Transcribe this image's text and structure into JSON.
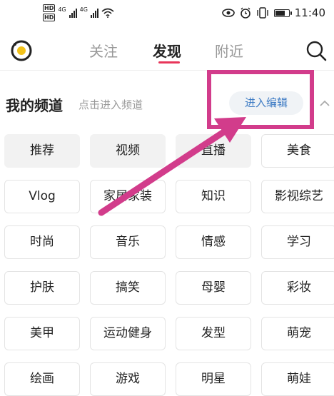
{
  "status_bar": {
    "hd_labels": [
      "HD",
      "HD"
    ],
    "network_labels": [
      "4G",
      "4G"
    ],
    "time": "11:40",
    "icons": [
      "eye-icon",
      "alarm-icon",
      "vibrate-icon",
      "battery-icon"
    ],
    "battery_level": 0.75
  },
  "nav": {
    "tabs": [
      {
        "label": "关注",
        "active": false
      },
      {
        "label": "发现",
        "active": true
      },
      {
        "label": "附近",
        "active": false
      }
    ],
    "accent_color": "#e8365a",
    "icons": [
      "app-logo-icon",
      "search-icon"
    ]
  },
  "channels": {
    "title": "我的频道",
    "hint": "点击进入频道",
    "edit_label": "进入编辑",
    "collapse_icon": "chevron-up-icon",
    "items": [
      {
        "label": "推荐",
        "fixed": true
      },
      {
        "label": "视频",
        "fixed": true
      },
      {
        "label": "直播",
        "fixed": true
      },
      {
        "label": "美食",
        "fixed": false
      },
      {
        "label": "Vlog",
        "fixed": false
      },
      {
        "label": "家居家装",
        "fixed": false
      },
      {
        "label": "知识",
        "fixed": false
      },
      {
        "label": "影视综艺",
        "fixed": false
      },
      {
        "label": "时尚",
        "fixed": false
      },
      {
        "label": "音乐",
        "fixed": false
      },
      {
        "label": "情感",
        "fixed": false
      },
      {
        "label": "学习",
        "fixed": false
      },
      {
        "label": "护肤",
        "fixed": false
      },
      {
        "label": "搞笑",
        "fixed": false
      },
      {
        "label": "母婴",
        "fixed": false
      },
      {
        "label": "彩妆",
        "fixed": false
      },
      {
        "label": "美甲",
        "fixed": false
      },
      {
        "label": "运动健身",
        "fixed": false
      },
      {
        "label": "发型",
        "fixed": false
      },
      {
        "label": "萌宠",
        "fixed": false
      },
      {
        "label": "绘画",
        "fixed": false
      },
      {
        "label": "游戏",
        "fixed": false
      },
      {
        "label": "明星",
        "fixed": false
      },
      {
        "label": "萌娃",
        "fixed": false
      }
    ]
  },
  "annotation": {
    "color": "#d23c8b"
  }
}
